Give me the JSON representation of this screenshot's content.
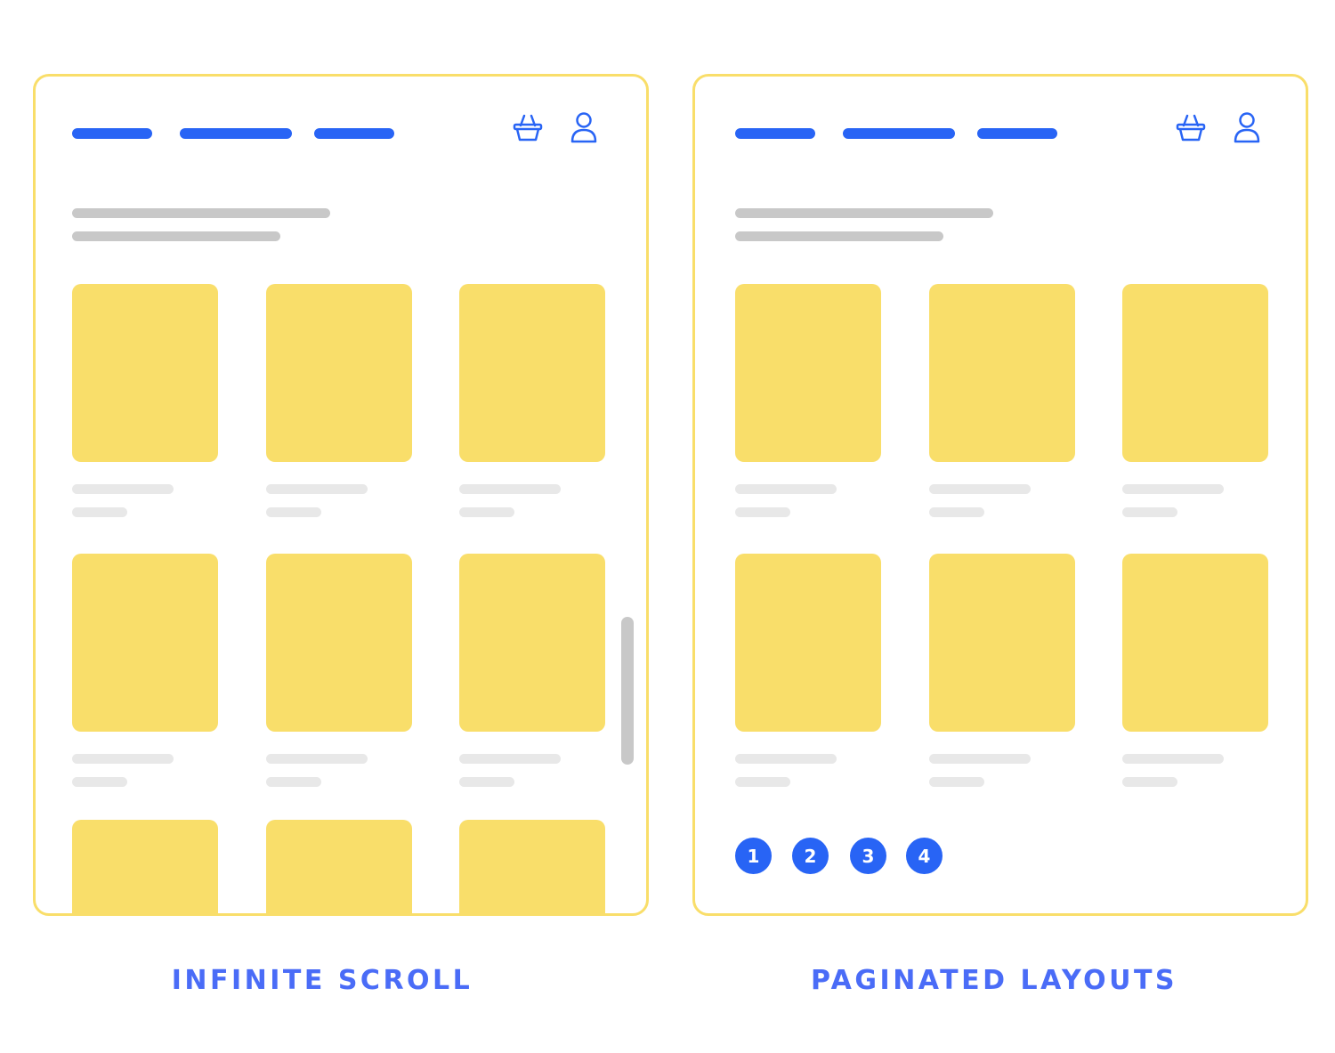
{
  "colors": {
    "accent_blue": "#2864f5",
    "caption_blue": "#4a6cf7",
    "frame_yellow": "#f9de6a",
    "card_yellow": "#f9de6a",
    "heading_gray": "#c8c8c8",
    "meta_gray": "#e8e8e8",
    "scrollbar_gray": "#c8c8c8"
  },
  "panels": [
    {
      "id": "infinite-scroll",
      "caption": "INFINITE SCROLL",
      "header_icons": [
        "basket-icon",
        "user-icon"
      ],
      "nav_links": 3,
      "product_rows_visible": 3,
      "has_scrollbar": true
    },
    {
      "id": "paginated-layouts",
      "caption": "PAGINATED LAYOUTS",
      "header_icons": [
        "basket-icon",
        "user-icon"
      ],
      "nav_links": 3,
      "product_rows_visible": 2,
      "pagination": [
        "1",
        "2",
        "3",
        "4"
      ]
    }
  ]
}
